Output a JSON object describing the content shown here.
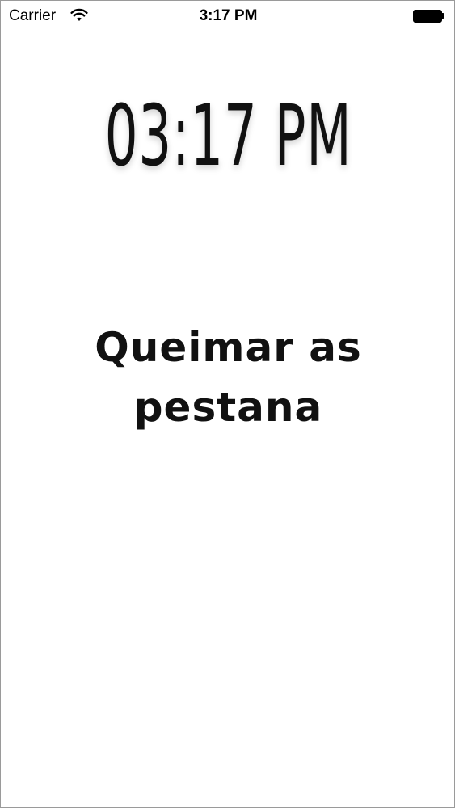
{
  "status_bar": {
    "carrier": "Carrier",
    "time": "3:17 PM",
    "icons": [
      "wifi-icon",
      "battery-icon"
    ]
  },
  "main": {
    "clock_time": "03:17 PM",
    "message": "Queimar as pestana"
  }
}
